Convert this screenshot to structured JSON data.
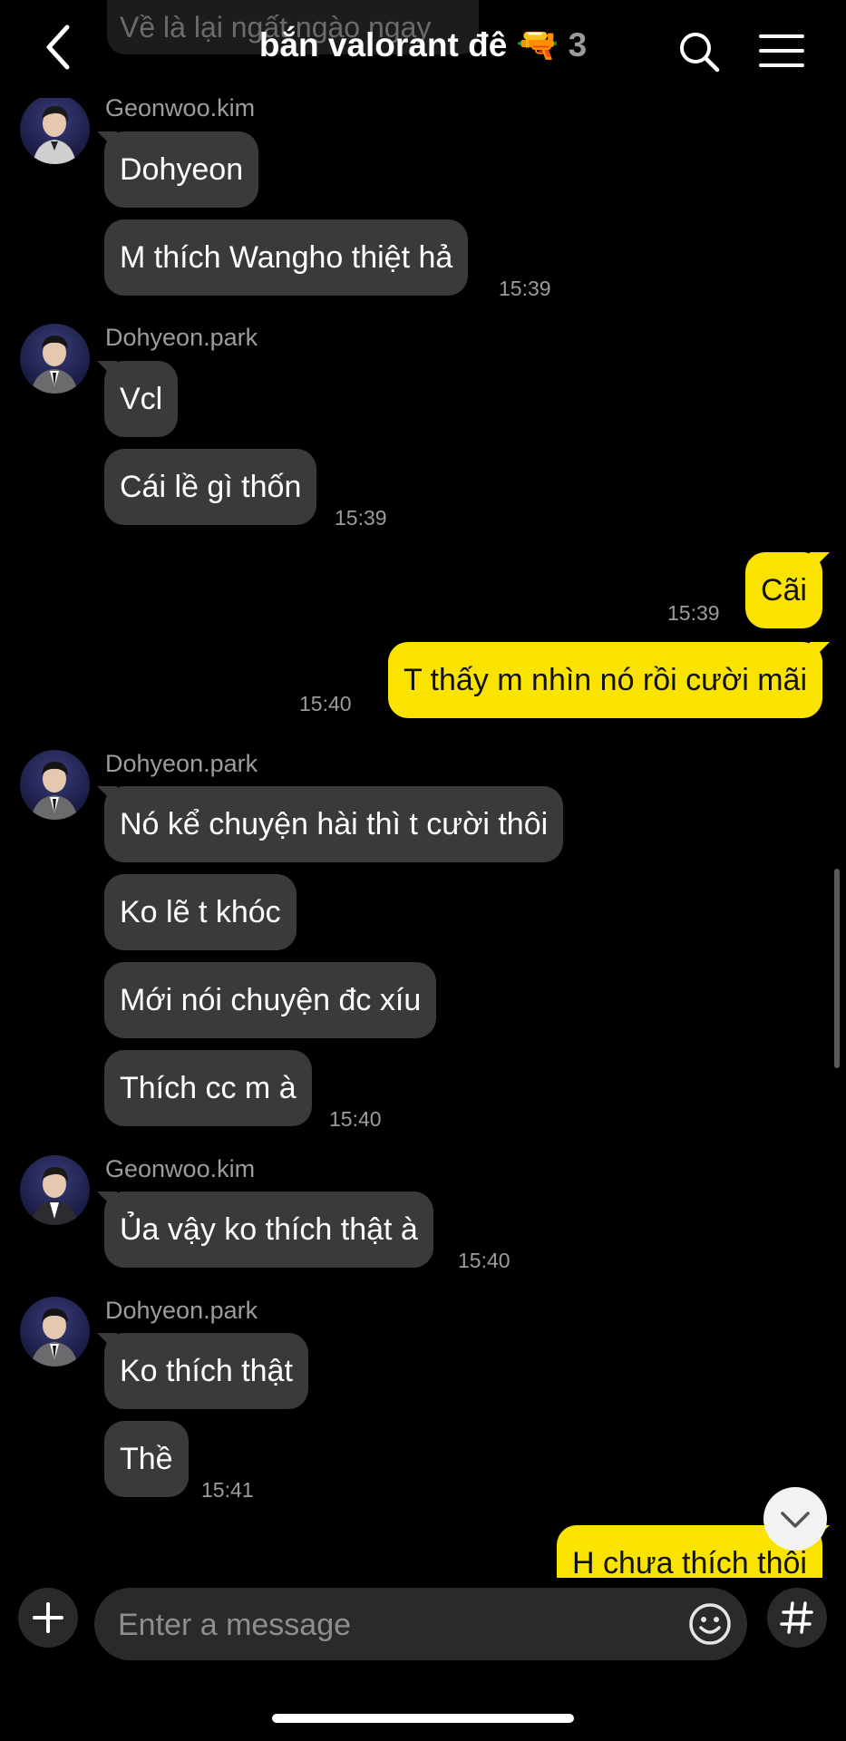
{
  "header": {
    "partial_prev_message": "Về là lại ngất ngào ngay",
    "title": "bắn valorant đê",
    "title_emoji": "🔫",
    "member_count": "3"
  },
  "messages": [
    {
      "sender": "Geonwoo.kim",
      "bubbles": [
        "Dohyeon",
        "M thích Wangho thiệt hả"
      ],
      "time": "15:39"
    },
    {
      "sender": "Dohyeon.park",
      "bubbles": [
        "Vcl",
        "Cái lề gì thốn"
      ],
      "time": "15:39"
    },
    {
      "sender": "me",
      "bubbles": [
        "Cãi"
      ],
      "time": "15:39"
    },
    {
      "sender": "me",
      "bubbles": [
        "T thấy m nhìn nó rồi cười mãi"
      ],
      "time": "15:40"
    },
    {
      "sender": "Dohyeon.park",
      "bubbles": [
        "Nó kể chuyện hài thì t cười thôi",
        "Ko lẽ t khóc",
        "Mới nói chuyện đc xíu",
        "Thích cc m à"
      ],
      "time": "15:40"
    },
    {
      "sender": "Geonwoo.kim",
      "bubbles": [
        "Ủa vậy ko thích thật à"
      ],
      "time": "15:40"
    },
    {
      "sender": "Dohyeon.park",
      "bubbles": [
        "Ko thích thật",
        "Thề"
      ],
      "time": "15:41"
    },
    {
      "sender": "me",
      "bubbles": [
        "H chưa thích thôi"
      ],
      "time": ""
    }
  ],
  "composer": {
    "placeholder": "Enter a message"
  },
  "colors": {
    "outgoing_bubble": "#fbe300",
    "incoming_bubble": "#3a3a3c",
    "background": "#000000"
  }
}
